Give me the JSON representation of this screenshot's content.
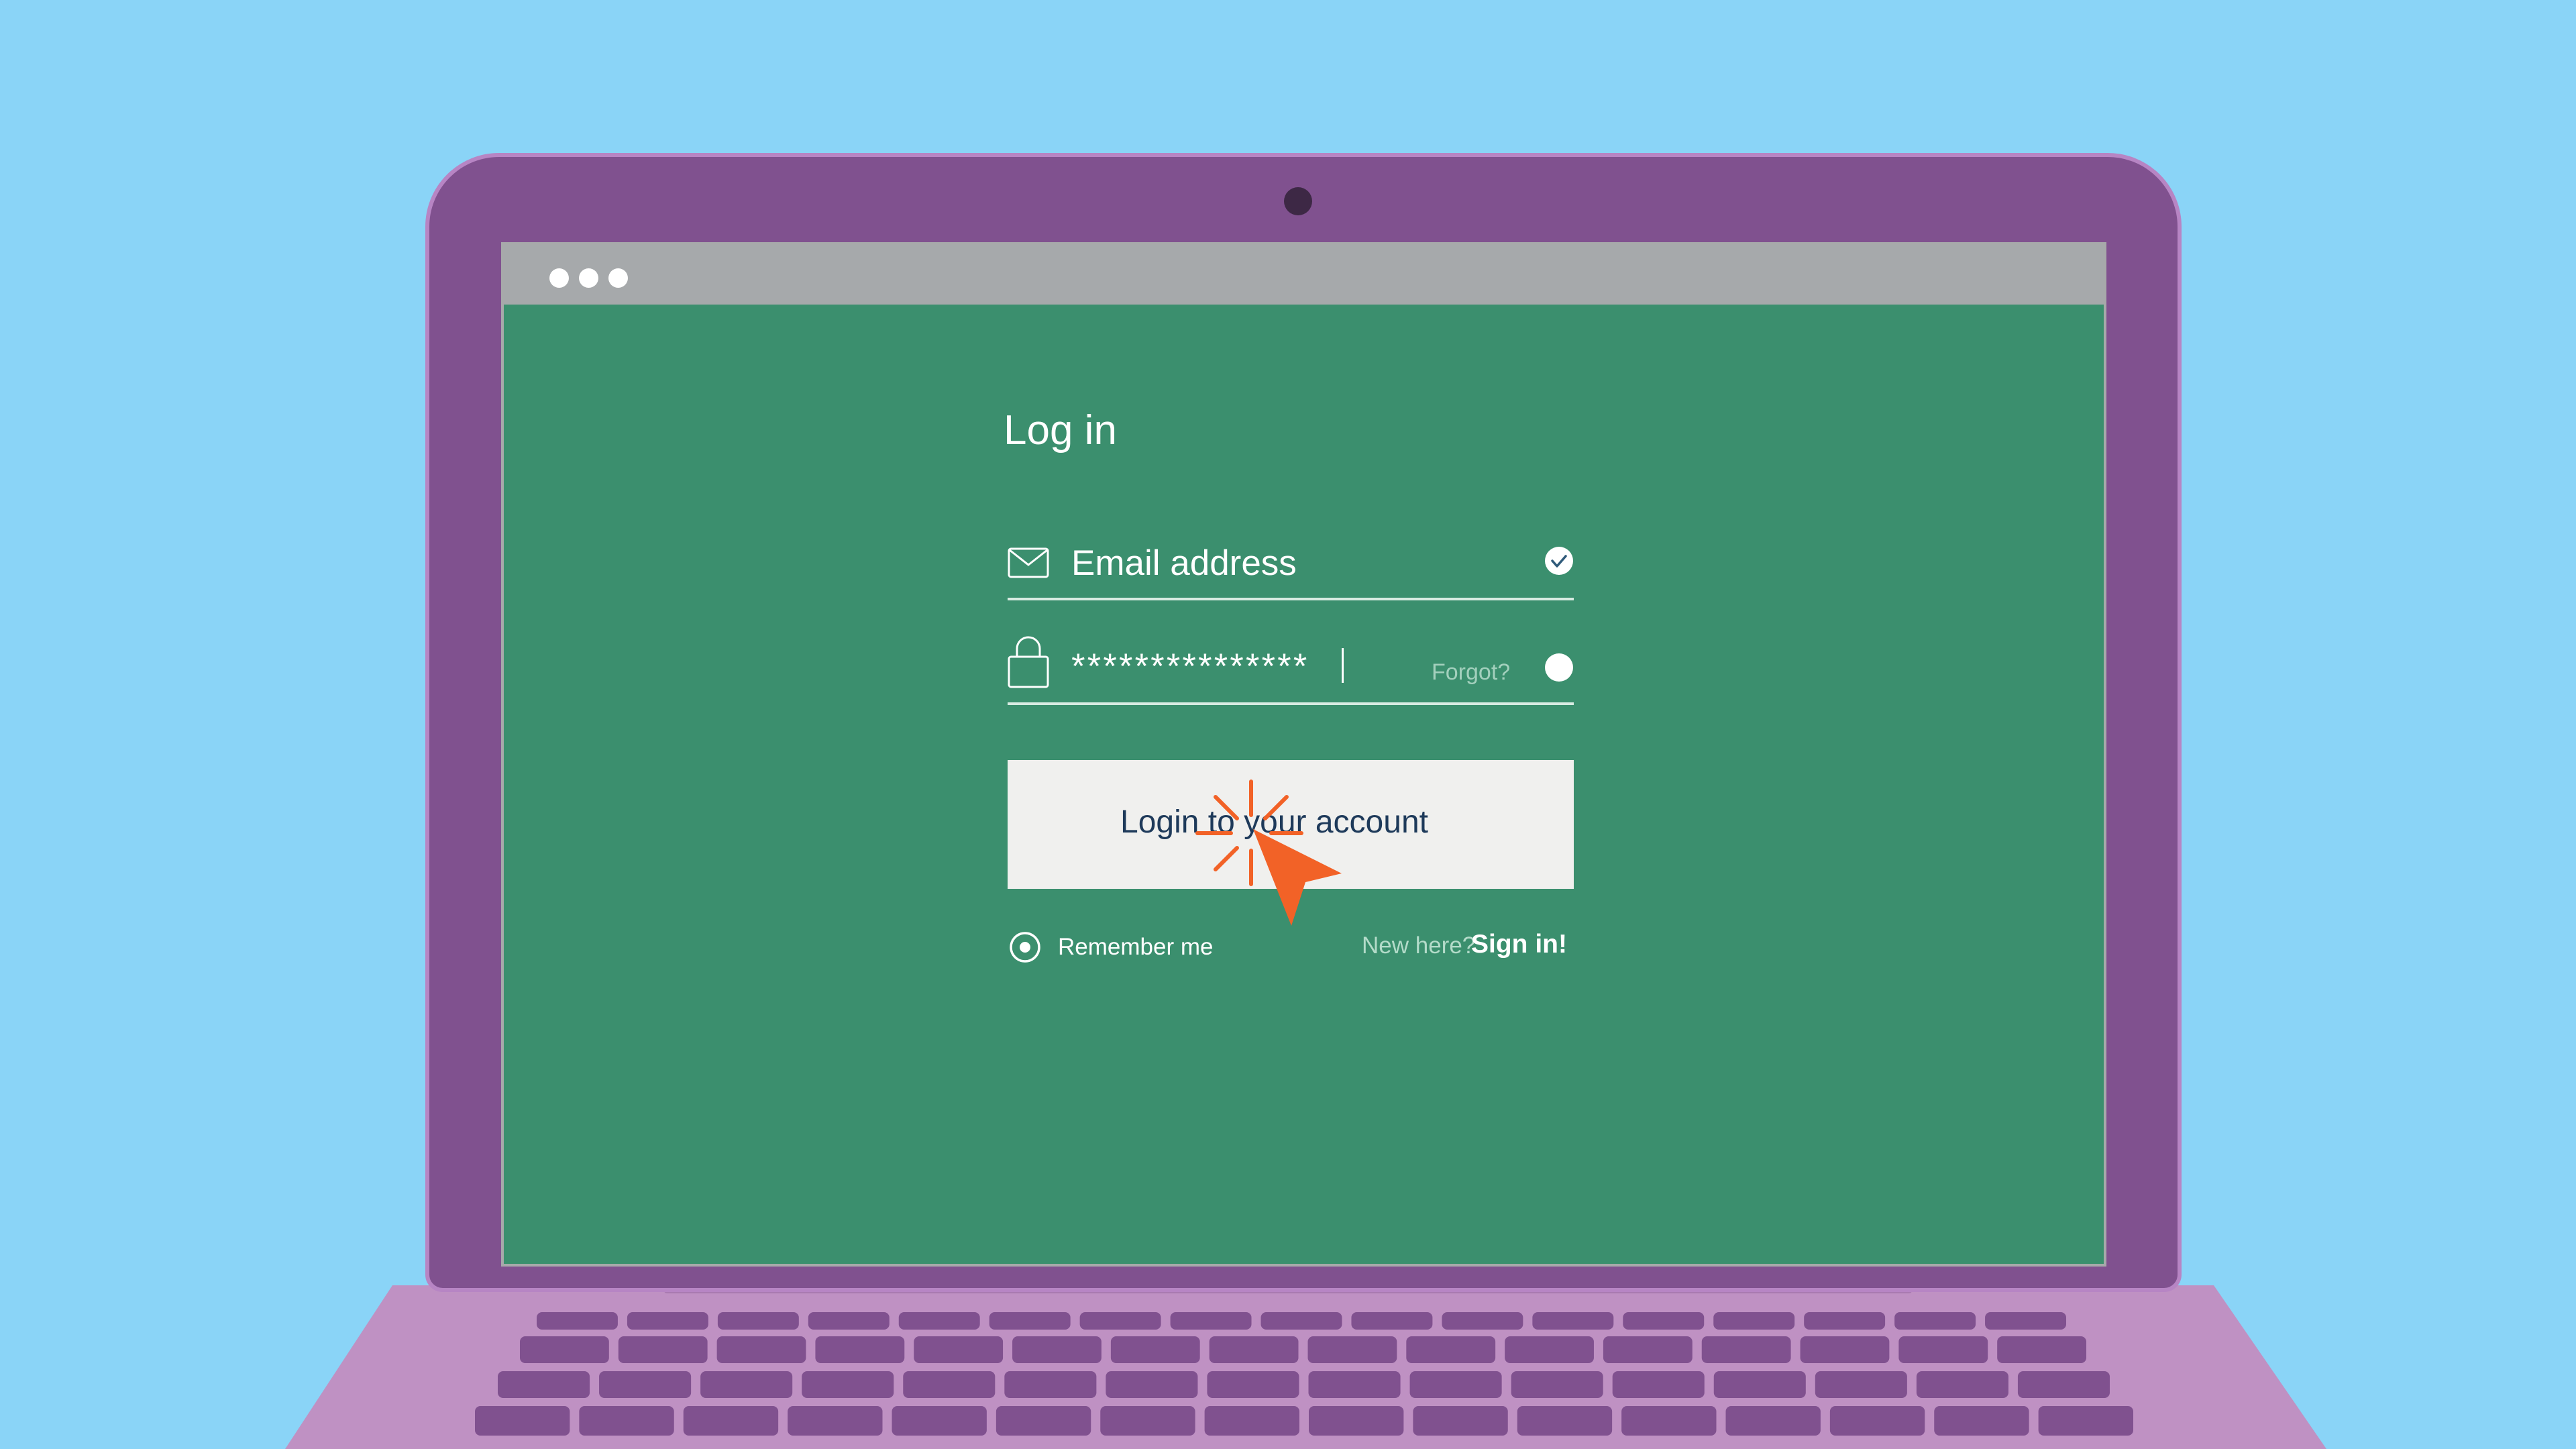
{
  "login": {
    "title": "Log in",
    "email_placeholder": "Email address",
    "password_value": "***************",
    "forgot_label": "Forgot?",
    "button_label": "Login to your account",
    "remember_label": "Remember me",
    "new_here_label": "New here?",
    "sign_in_label": "Sign in!"
  },
  "icons": {
    "email": "envelope-icon",
    "password": "lock-icon",
    "email_status": "check-icon",
    "cursor": "mouse-pointer-icon",
    "click": "click-burst-icon"
  },
  "colors": {
    "background": "#8ad4f7",
    "laptop_lid": "#80518f",
    "laptop_base": "#bf91c3",
    "keys": "#80518f",
    "screen": "#3b8f6e",
    "titlebar": "#a6a9ab",
    "button": "#f0f0ee",
    "button_text": "#1e3a5a",
    "cursor": "#f26227"
  }
}
